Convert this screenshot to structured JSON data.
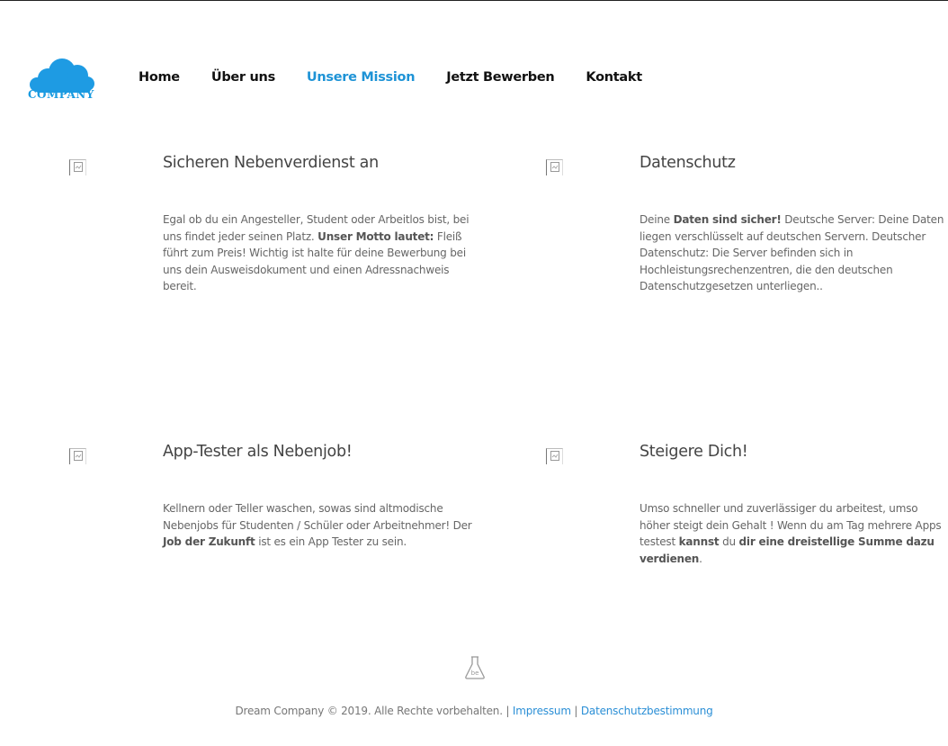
{
  "brand": {
    "logo_text": "COMPANY",
    "accent": "#1e93d6"
  },
  "nav": {
    "items": [
      {
        "label": "Home"
      },
      {
        "label": "Über uns"
      },
      {
        "label": "Unsere Mission"
      },
      {
        "label": "Jetzt Bewerben"
      },
      {
        "label": "Kontakt"
      }
    ],
    "active_index": 2
  },
  "features": [
    {
      "title": "Sicheren Nebenverdienst an",
      "text_parts": [
        {
          "t": "Egal ob du ein Angesteller, Student oder Arbeitlos bist, bei uns findet jeder seinen Platz. ",
          "b": false
        },
        {
          "t": "Unser Motto lautet:",
          "b": true
        },
        {
          "t": " Fleiß führt zum Preis! Wichtig ist halte für deine Bewerbung bei uns dein Ausweisdokument und einen Adressnachweis bereit.",
          "b": false
        }
      ]
    },
    {
      "title": "Datenschutz",
      "text_parts": [
        {
          "t": "Deine ",
          "b": false
        },
        {
          "t": "Daten sind sicher!",
          "b": true
        },
        {
          "t": " Deutsche Server: Deine Daten liegen verschlüsselt auf deutschen Servern. Deutscher Datenschutz: Die Server befinden sich in Hochleistungsrechenzentren, die den deutschen Datenschutzgesetzen unterliegen..",
          "b": false
        }
      ]
    },
    {
      "title": "App-Tester als Nebenjob!",
      "text_parts": [
        {
          "t": "Kellnern oder Teller waschen, sowas sind altmodische Nebenjobs für Studenten / Schüler oder Arbeitnehmer! Der ",
          "b": false
        },
        {
          "t": "Job der Zukunft",
          "b": true
        },
        {
          "t": " ist es ein App Tester zu sein.",
          "b": false
        }
      ]
    },
    {
      "title": "Steigere Dich!",
      "text_parts": [
        {
          "t": "Umso schneller und zuverlässiger du arbeitest, umso höher steigt dein Gehalt ! Wenn du am Tag mehrere Apps testest ",
          "b": false
        },
        {
          "t": "kannst",
          "b": true
        },
        {
          "t": " du ",
          "b": false
        },
        {
          "t": "dir eine dreistellige Summe dazu verdienen",
          "b": true
        },
        {
          "t": ".",
          "b": false
        }
      ]
    }
  ],
  "footer": {
    "copyright": "Dream Company © 2019. Alle Rechte vorbehalten. | ",
    "link1": "Impressum",
    "sep": " | ",
    "link2": "Datenschutzbestimmung",
    "icon": "flask-be-icon"
  }
}
